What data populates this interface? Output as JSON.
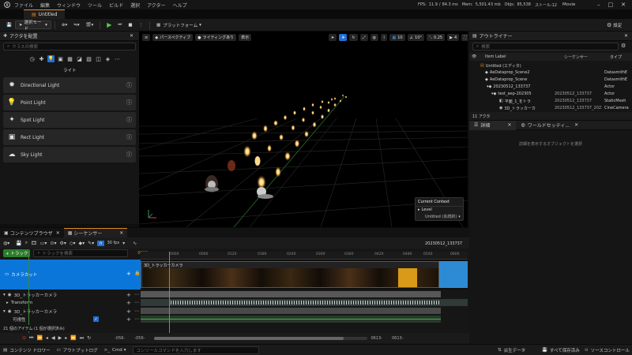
{
  "menubar": {
    "items": [
      "ファイル",
      "編集",
      "ウィンドウ",
      "ツール",
      "ビルド",
      "選択",
      "アクター",
      "ヘルプ"
    ],
    "stats": {
      "fps_label": "FPS:",
      "fps": "11.9",
      "ms": "84.3 ms",
      "mem_label": "Mem:",
      "mem": "5,501.43 mb",
      "objs_label": "Objs:",
      "objs": "85,538",
      "stalls": "ストール:12"
    },
    "mode": "Movie"
  },
  "tabs": {
    "level": "Untitled"
  },
  "toolbar": {
    "select_mode": "選択モード",
    "platforms": "プラットフォーム",
    "settings": "設定"
  },
  "place_actors": {
    "title": "アクタを配置",
    "search_placeholder": "クラスの検索",
    "category": "ライト",
    "items": [
      {
        "label": "Directional Light",
        "icon": "directional-light-icon"
      },
      {
        "label": "Point Light",
        "icon": "point-light-icon"
      },
      {
        "label": "Spot Light",
        "icon": "spot-light-icon"
      },
      {
        "label": "Rect Light",
        "icon": "rect-light-icon"
      },
      {
        "label": "Sky Light",
        "icon": "sky-light-icon"
      }
    ]
  },
  "viewport": {
    "perspective": "パースペクティブ",
    "lighting": "ライティングあり",
    "show": "表示",
    "grid_snap": "10",
    "rot_snap": "10°",
    "scale_snap": "0.25",
    "cam_speed": "4",
    "current_context": {
      "title": "Current Context",
      "level_label": "Level",
      "level": "Untitled (永続的)"
    }
  },
  "outliner": {
    "title": "アウトライナー",
    "search_placeholder": "検索",
    "col_label": "Item Label",
    "col_sequencer": "シーケンサー",
    "col_type": "タイプ",
    "rows": [
      {
        "label": "Untitled (エディタ)",
        "seq": "",
        "type": ""
      },
      {
        "label": "AeDataprop_Scene2",
        "seq": "",
        "type": "DatasmithE"
      },
      {
        "label": "AeDataprop_Scene",
        "seq": "",
        "type": "DatasmithE"
      },
      {
        "label": "20230512_133737",
        "seq": "",
        "type": "Actor"
      },
      {
        "label": "test_aep-202305",
        "seq": "20230512_133737",
        "type": "Actor"
      },
      {
        "label": "平面_1_をトラ",
        "seq": "20230512_133737",
        "type": "StaticMesh"
      },
      {
        "label": "3D_トラッカーカ",
        "seq": "20230512_133737_20230512_1",
        "type": "CineCamera"
      }
    ],
    "count": "11 アクタ"
  },
  "details": {
    "tab1": "詳細",
    "tab2": "ワールドセッティ...",
    "empty": "詳細を表示するオブジェクトを選択"
  },
  "bottom": {
    "tab_content": "コンテンツブラウザ",
    "tab_sequencer": "シーケンサー",
    "fps": "30 fps",
    "sequence_name": "20230512_133737",
    "add_track": "+ トラック",
    "track_search": "トラックを検索",
    "frame_counter": "0613",
    "tracks": [
      {
        "label": "カメラカット"
      },
      {
        "label": "3D_トラッカーカメラ"
      },
      {
        "label": "Transform"
      },
      {
        "label": "3D_トラッカーカメラ"
      },
      {
        "label": "可視性"
      }
    ],
    "clip_label": "3D_トラッカーカメラ",
    "ruler_labels": [
      "0000",
      "0060",
      "0120",
      "0180",
      "0240",
      "0300",
      "0360",
      "0420",
      "0480",
      "0540",
      "0600"
    ],
    "selection_info": "21 個のアイテム (1 個が選択済み)",
    "start": "-056-",
    "start2": "-056-",
    "end": "0613-",
    "end2": "0613-"
  },
  "statusbar": {
    "content_drawer": "コンテンツ ドロワー",
    "output_log": "アウトプットログ",
    "cmd": "Cmd",
    "console_placeholder": "コンソールコマンドを入力します",
    "derived_data": "派生データ",
    "save_all": "すべて保存済み",
    "source_control": "ソースコントロール"
  }
}
